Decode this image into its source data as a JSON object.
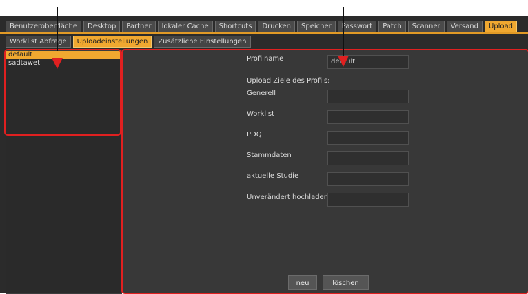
{
  "colors": {
    "accent": "#f0a830",
    "annotation": "#e02020",
    "background": "#2b2b2b"
  },
  "top_tabs": [
    {
      "label": "Benutzeroberfläche",
      "active": false
    },
    {
      "label": "Desktop",
      "active": false
    },
    {
      "label": "Partner",
      "active": false
    },
    {
      "label": "lokaler Cache",
      "active": false
    },
    {
      "label": "Shortcuts",
      "active": false
    },
    {
      "label": "Drucken",
      "active": false
    },
    {
      "label": "Speicher",
      "active": false
    },
    {
      "label": "Passwort",
      "active": false
    },
    {
      "label": "Patch",
      "active": false
    },
    {
      "label": "Scanner",
      "active": false
    },
    {
      "label": "Versand",
      "active": false
    },
    {
      "label": "Upload",
      "active": true
    }
  ],
  "sub_tabs": [
    {
      "label": "Worklist Abfrage",
      "active": false
    },
    {
      "label": "Uploadeinstellungen",
      "active": true
    },
    {
      "label": "Zusätzliche Einstellungen",
      "active": false
    }
  ],
  "profiles": [
    {
      "label": "default",
      "selected": true
    },
    {
      "label": "sadtawet",
      "selected": false
    }
  ],
  "form": {
    "profile_name_label": "Profilname",
    "profile_name_value": "default",
    "targets_heading": "Upload Ziele des Profils:",
    "fields": [
      {
        "label": "Generell",
        "value": ""
      },
      {
        "label": "Worklist",
        "value": ""
      },
      {
        "label": "PDQ",
        "value": ""
      },
      {
        "label": "Stammdaten",
        "value": ""
      },
      {
        "label": "aktuelle Studie",
        "value": ""
      },
      {
        "label": "Unverändert hochladen",
        "value": ""
      }
    ]
  },
  "buttons": {
    "new_label": "neu",
    "delete_label": "löschen"
  }
}
